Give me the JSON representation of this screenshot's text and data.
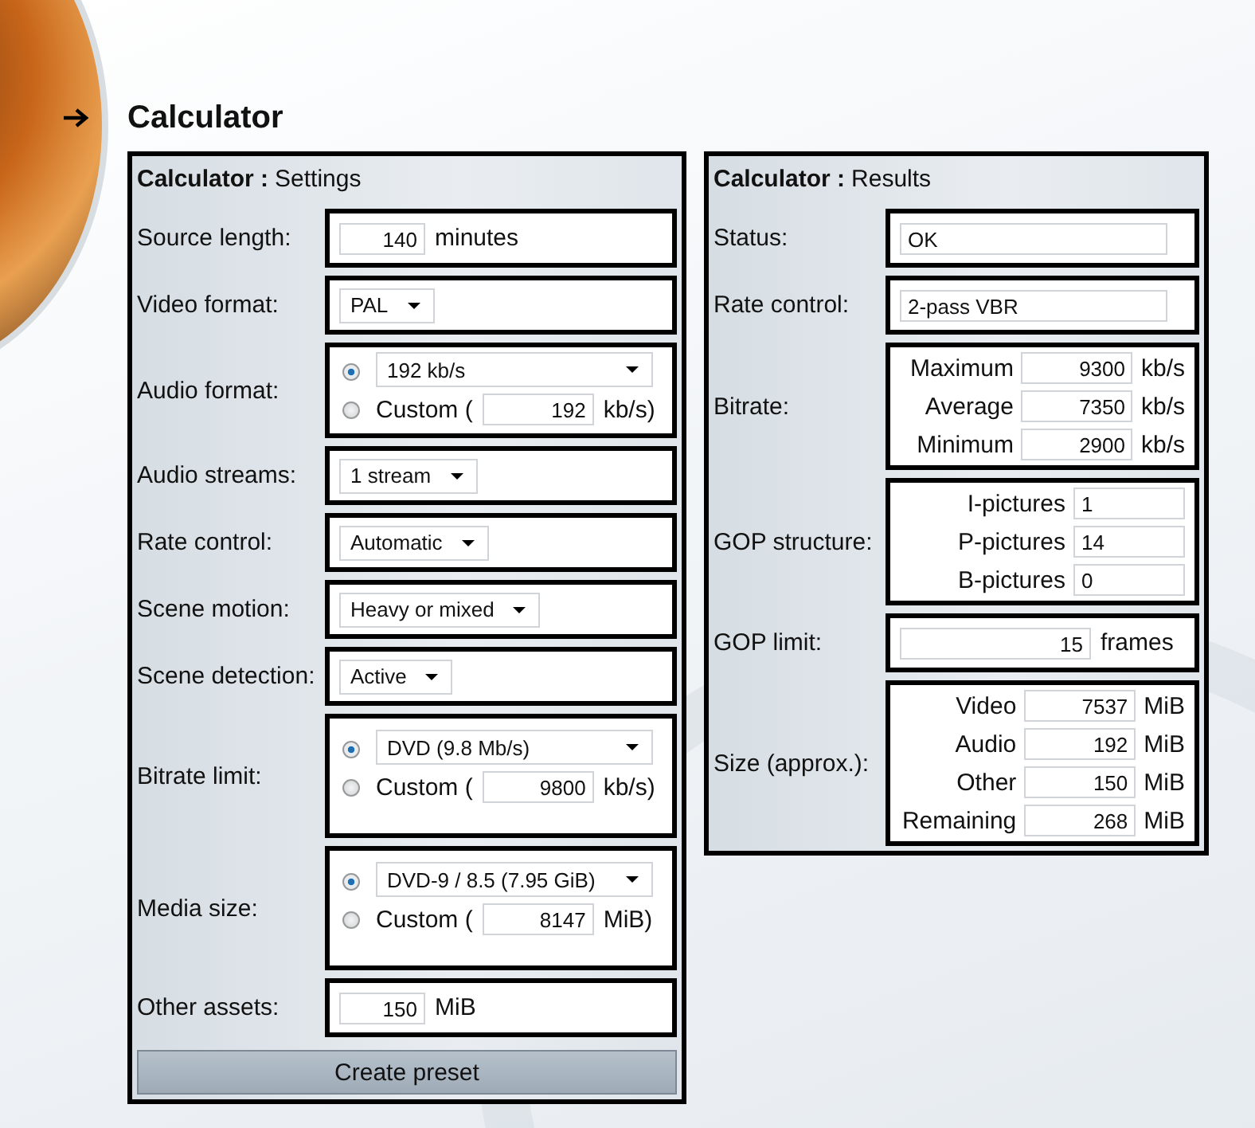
{
  "page_title": "Calculator",
  "settings": {
    "title_bold": "Calculator :",
    "title_rest": "Settings",
    "rows": [
      {
        "kind": "number",
        "label": "Source length:",
        "value": "140",
        "unit": "minutes"
      },
      {
        "kind": "select",
        "label": "Video format:",
        "value": "PAL"
      },
      {
        "kind": "radio",
        "label": "Audio format:",
        "select_value": "192 kb/s",
        "custom_label": "Custom (",
        "custom_value": "192",
        "custom_unit": "kb/s)",
        "preset_selected": true,
        "custom_selected": false
      },
      {
        "kind": "select",
        "label": "Audio streams:",
        "value": "1 stream"
      },
      {
        "kind": "select",
        "label": "Rate control:",
        "value": "Automatic"
      },
      {
        "kind": "select",
        "label": "Scene motion:",
        "value": "Heavy or mixed"
      },
      {
        "kind": "select",
        "label": "Scene detection:",
        "value": "Active"
      },
      {
        "kind": "radio",
        "label": "Bitrate limit:",
        "select_value": "DVD (9.8 Mb/s)",
        "custom_label": "Custom (",
        "custom_value": "9800",
        "custom_unit": "kb/s)",
        "preset_selected": true,
        "custom_selected": false
      },
      {
        "kind": "radio",
        "label": "Media size:",
        "select_value": "DVD-9 / 8.5 (7.95 GiB)",
        "custom_label": "Custom (",
        "custom_value": "8147",
        "custom_unit": "MiB)",
        "preset_selected": true,
        "custom_selected": false
      },
      {
        "kind": "number",
        "label": "Other assets:",
        "value": "150",
        "unit": "MiB"
      }
    ],
    "button": "Create preset"
  },
  "results": {
    "title_bold": "Calculator :",
    "title_rest": "Results",
    "rows": [
      {
        "kind": "text",
        "label": "Status:",
        "value": "OK"
      },
      {
        "kind": "text",
        "label": "Rate control:",
        "value": "2-pass VBR"
      },
      {
        "kind": "multi",
        "label": "Bitrate:",
        "fields": [
          {
            "label": "Maximum",
            "value": "9300",
            "unit": "kb/s"
          },
          {
            "label": "Average",
            "value": "7350",
            "unit": "kb/s"
          },
          {
            "label": "Minimum",
            "value": "2900",
            "unit": "kb/s"
          }
        ]
      },
      {
        "kind": "multi",
        "label": "GOP structure:",
        "fields": [
          {
            "label": "I-pictures",
            "value": "1"
          },
          {
            "label": "P-pictures",
            "value": "14"
          },
          {
            "label": "B-pictures",
            "value": "0"
          }
        ]
      },
      {
        "kind": "number",
        "label": "GOP limit:",
        "value": "15",
        "unit": "frames"
      },
      {
        "kind": "multi",
        "label": "Size (approx.):",
        "fields": [
          {
            "label": "Video",
            "value": "7537",
            "unit": "MiB"
          },
          {
            "label": "Audio",
            "value": "192",
            "unit": "MiB"
          },
          {
            "label": "Other",
            "value": "150",
            "unit": "MiB"
          },
          {
            "label": "Remaining",
            "value": "268",
            "unit": "MiB"
          }
        ]
      }
    ]
  }
}
